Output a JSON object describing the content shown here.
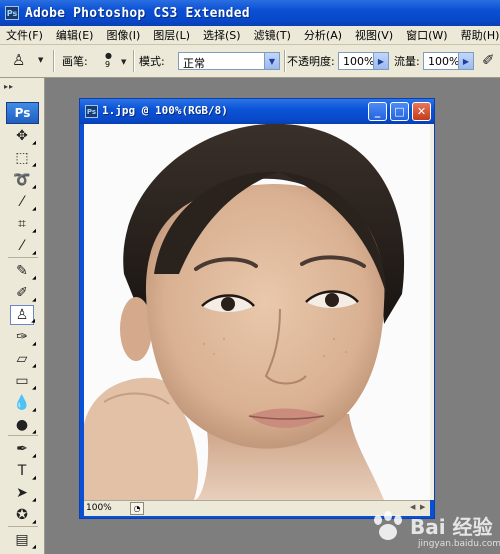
{
  "app": {
    "title": "Adobe Photoshop CS3 Extended",
    "badge": "Ps"
  },
  "menu": [
    "文件(F)",
    "编辑(E)",
    "图像(I)",
    "图层(L)",
    "选择(S)",
    "滤镜(T)",
    "分析(A)",
    "视图(V)",
    "窗口(W)",
    "帮助(H)"
  ],
  "options": {
    "brush_label": "画笔:",
    "brush_size": "9",
    "mode_label": "模式:",
    "mode_value": "正常",
    "opacity_label": "不透明度:",
    "opacity_value": "100%",
    "flow_label": "流量:",
    "flow_value": "100%"
  },
  "toolbox": {
    "logo": "Ps",
    "tools": [
      {
        "name": "move-tool-icon",
        "glyph": "✥"
      },
      {
        "name": "marquee-tool-icon",
        "glyph": "⬚"
      },
      {
        "name": "lasso-tool-icon",
        "glyph": "➰"
      },
      {
        "name": "magic-wand-tool-icon",
        "glyph": "⁄"
      },
      {
        "name": "crop-tool-icon",
        "glyph": "⌗"
      },
      {
        "name": "eyedropper-tool-icon",
        "glyph": "⁄"
      },
      {
        "name": "healing-brush-tool-icon",
        "glyph": "✎"
      },
      {
        "name": "brush-tool-icon",
        "glyph": "✐"
      },
      {
        "name": "clone-stamp-tool-icon",
        "glyph": "♙"
      },
      {
        "name": "history-brush-tool-icon",
        "glyph": "✑"
      },
      {
        "name": "eraser-tool-icon",
        "glyph": "▱"
      },
      {
        "name": "gradient-tool-icon",
        "glyph": "▭"
      },
      {
        "name": "blur-tool-icon",
        "glyph": "💧"
      },
      {
        "name": "dodge-tool-icon",
        "glyph": "●"
      },
      {
        "name": "pen-tool-icon",
        "glyph": "✒"
      },
      {
        "name": "type-tool-icon",
        "glyph": "T"
      },
      {
        "name": "path-selection-tool-icon",
        "glyph": "➤"
      },
      {
        "name": "shape-tool-icon",
        "glyph": "✪"
      },
      {
        "name": "notes-tool-icon",
        "glyph": "▤"
      },
      {
        "name": "eyedropper-2-tool-icon",
        "glyph": "⁄"
      }
    ]
  },
  "document": {
    "title": "1.jpg @ 100%(RGB/8)",
    "badge": "Ps",
    "zoom": "100%",
    "photo": "portrait of a woman"
  },
  "watermark": {
    "brand": "Bai 经验",
    "url": "jingyan.baidu.com"
  },
  "colors": {
    "xp_blue": "#0a4fd4",
    "chrome": "#ece9d8",
    "workspace": "#7e7e7e"
  }
}
